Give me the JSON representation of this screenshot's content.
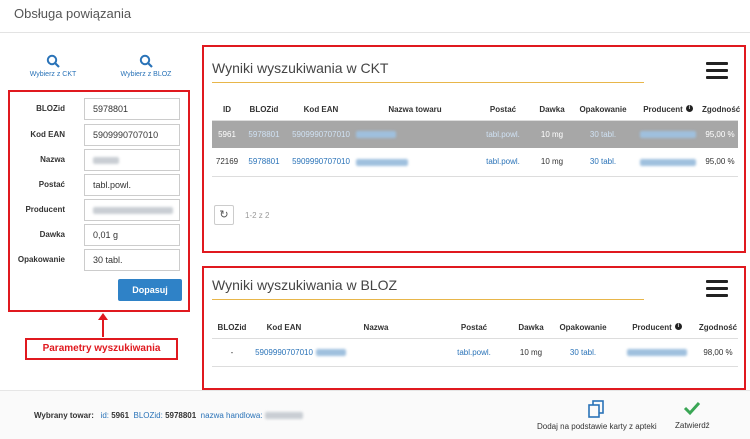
{
  "page": {
    "title": "Obsługa powiązania"
  },
  "pickers": {
    "ckt": {
      "label": "Wybierz z CKT",
      "icon": "search-icon"
    },
    "bloz": {
      "label": "Wybierz z BLOZ",
      "icon": "search-icon"
    }
  },
  "params": {
    "fields": [
      {
        "label": "BLOZid",
        "value": "5978801"
      },
      {
        "label": "Kod EAN",
        "value": "5909990707010"
      },
      {
        "label": "Nazwa",
        "value": ""
      },
      {
        "label": "Postać",
        "value": "tabl.powl."
      },
      {
        "label": "Producent",
        "value": ""
      },
      {
        "label": "Dawka",
        "value": "0,01 g"
      },
      {
        "label": "Opakowanie",
        "value": "30 tabl."
      }
    ],
    "button": "Dopasuj",
    "caption": "Parametry wyszukiwania"
  },
  "ckt": {
    "title": "Wyniki wyszukiwania w CKT",
    "headers": [
      "ID",
      "BLOZid",
      "Kod EAN",
      "Nazwa towaru",
      "Postać",
      "Dawka",
      "Opakowanie",
      "Producent",
      "Zgodność"
    ],
    "rows": [
      {
        "id": "5961",
        "bloz": "5978801",
        "ean": "5909990707010",
        "postac": "tabl.powl.",
        "dawka": "10 mg",
        "opak": "30 tabl.",
        "zgodnosc": "95,00 %"
      },
      {
        "id": "72169",
        "bloz": "5978801",
        "ean": "5909990707010",
        "postac": "tabl.powl.",
        "dawka": "10 mg",
        "opak": "30 tabl.",
        "zgodnosc": "95,00 %"
      }
    ],
    "pager": "1-2 z 2"
  },
  "bloz": {
    "title": "Wyniki wyszukiwania w BLOZ",
    "headers": [
      "BLOZid",
      "Kod EAN",
      "Nazwa",
      "Postać",
      "Dawka",
      "Opakowanie",
      "Producent",
      "Zgodność"
    ],
    "rows": [
      {
        "bloz": "-",
        "ean": "5909990707010",
        "postac": "tabl.powl.",
        "dawka": "10 mg",
        "opak": "30 tabl.",
        "zgodnosc": "98,00 %"
      }
    ]
  },
  "footer": {
    "label": "Wybrany towar:",
    "id_label": "id:",
    "id": "5961",
    "bloz_label": "BLOZid:",
    "bloz": "5978801",
    "name_label": "nazwa handlowa:",
    "action_copy": "Dodaj na podstawie karty z apteki",
    "action_confirm": "Zatwierdź"
  },
  "colors": {
    "accent": "#2f82c7",
    "highlight": "#e0191f",
    "selected_row": "#a7a7a7",
    "confirm": "#3aa655"
  }
}
